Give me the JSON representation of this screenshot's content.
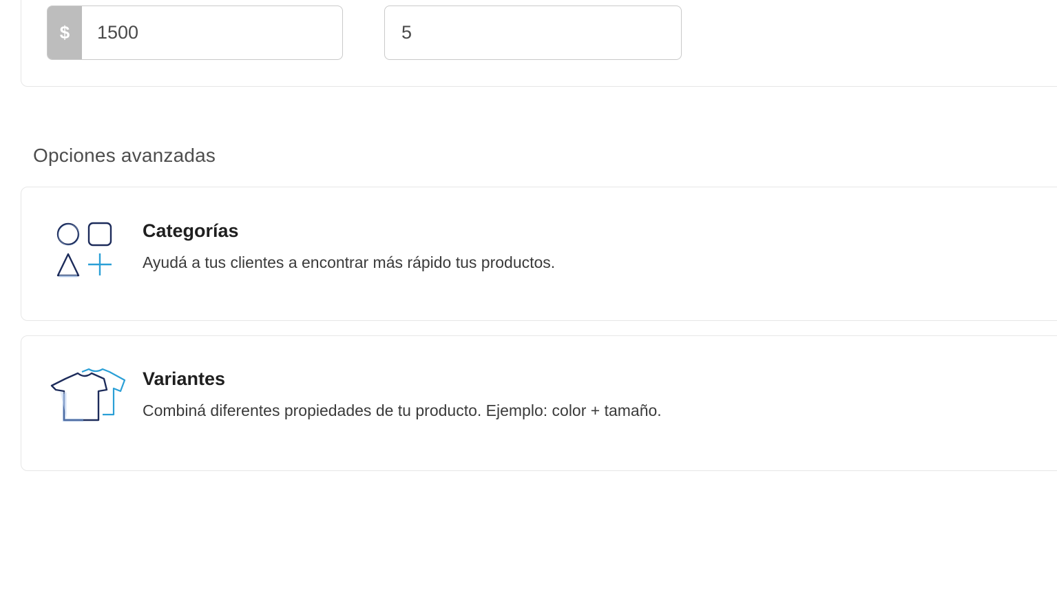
{
  "pricing": {
    "currency_symbol": "$",
    "price_value": "1500",
    "stock_value": "5"
  },
  "advanced_options": {
    "heading": "Opciones avanzadas",
    "items": [
      {
        "title": "Categorías",
        "description": "Ayudá a tus clientes a encontrar más rápido tus productos.",
        "icon": "shapes-icon"
      },
      {
        "title": "Variantes",
        "description": "Combiná diferentes propiedades de tu producto. Ejemplo: color + tamaño.",
        "icon": "tshirts-icon"
      }
    ]
  },
  "colors": {
    "icon_dark": "#1c2b5a",
    "icon_accent": "#2a9fd6",
    "prefix_bg": "#bdbdbd",
    "border": "#c9c9c9"
  }
}
